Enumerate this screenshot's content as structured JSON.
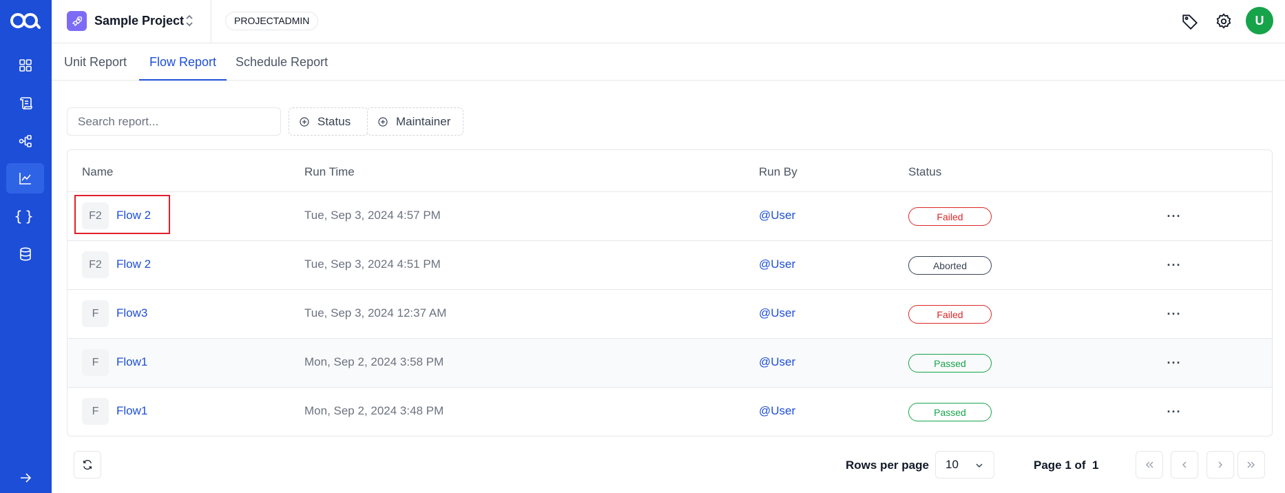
{
  "project": {
    "name": "Sample Project",
    "role": "PROJECTADMIN",
    "icon": "rocket-icon"
  },
  "user": {
    "avatar_initial": "U",
    "avatar_color": "#16a34a"
  },
  "tabs": [
    {
      "label": "Unit Report",
      "active": false
    },
    {
      "label": "Flow Report",
      "active": true
    },
    {
      "label": "Schedule Report",
      "active": false
    }
  ],
  "search": {
    "placeholder": "Search report...",
    "value": ""
  },
  "filters": {
    "status_label": "Status",
    "maintainer_label": "Maintainer"
  },
  "table": {
    "columns": {
      "name": "Name",
      "run_time": "Run Time",
      "run_by": "Run By",
      "status": "Status"
    },
    "rows": [
      {
        "initials": "F2",
        "name": "Flow 2",
        "run_time": "Tue, Sep 3, 2024 4:57 PM",
        "run_by": "@User",
        "status": "Failed"
      },
      {
        "initials": "F2",
        "name": "Flow 2",
        "run_time": "Tue, Sep 3, 2024 4:51 PM",
        "run_by": "@User",
        "status": "Aborted"
      },
      {
        "initials": "F",
        "name": "Flow3",
        "run_time": "Tue, Sep 3, 2024 12:37 AM",
        "run_by": "@User",
        "status": "Failed"
      },
      {
        "initials": "F",
        "name": "Flow1",
        "run_time": "Mon, Sep 2, 2024 3:58 PM",
        "run_by": "@User",
        "status": "Passed"
      },
      {
        "initials": "F",
        "name": "Flow1",
        "run_time": "Mon, Sep 2, 2024 3:48 PM",
        "run_by": "@User",
        "status": "Passed"
      }
    ]
  },
  "status_colors": {
    "Failed": "#dc2626",
    "Aborted": "#374151",
    "Passed": "#16a34a"
  },
  "accent_color": "#1d4ed8",
  "pagination": {
    "rows_per_page_label": "Rows per page",
    "rows_per_page_value": "10",
    "page_label": "Page 1 of  1"
  }
}
